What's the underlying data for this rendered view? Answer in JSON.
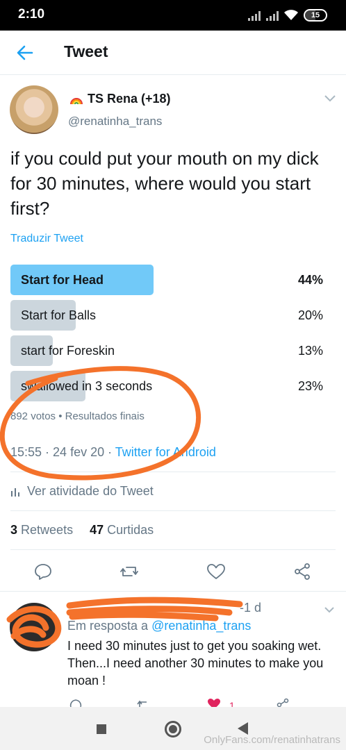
{
  "status_bar": {
    "time": "2:10",
    "battery": "15"
  },
  "header": {
    "title": "Tweet"
  },
  "tweet": {
    "display_name": "TS Rena (+18)",
    "handle": "@renatinha_trans",
    "text": "if you could put your mouth on my dick for 30 minutes, where would you start first?",
    "translate_label": "Traduzir Tweet",
    "poll": {
      "options": [
        {
          "label": "Start for Head",
          "percent": "44%",
          "value": 44,
          "winner": true
        },
        {
          "label": "Start for  Balls",
          "percent": "20%",
          "value": 20,
          "winner": false
        },
        {
          "label": "start for Foreskin",
          "percent": "13%",
          "value": 13,
          "winner": false
        },
        {
          "label": "swallowed in 3 seconds",
          "percent": "23%",
          "value": 23,
          "winner": false
        }
      ],
      "meta": "892 votos • Resultados finais"
    },
    "time": "15:55 · 24 fev 20 · ",
    "source": "Twitter for Android",
    "activity_label": "Ver atividade do Tweet",
    "retweets_count": "3",
    "retweets_label": "Retweets",
    "likes_count": "47",
    "likes_label": "Curtidas"
  },
  "reply": {
    "meta_visible": "-1 d",
    "in_reply_prefix": "Em resposta a ",
    "in_reply_handle": "@renatinha_trans",
    "text": "I need 30 minutes just to get you soaking wet. Then...I need another 30 minutes to make you moan !",
    "likes": "1"
  },
  "watermark": "OnlyFans.com/renatinhatrans",
  "colors": {
    "accent": "#1da1f2",
    "poll_winner": "#71c9f8",
    "poll_bar": "#ccd6dd",
    "scribble": "#f4722b",
    "like": "#e0245e"
  }
}
